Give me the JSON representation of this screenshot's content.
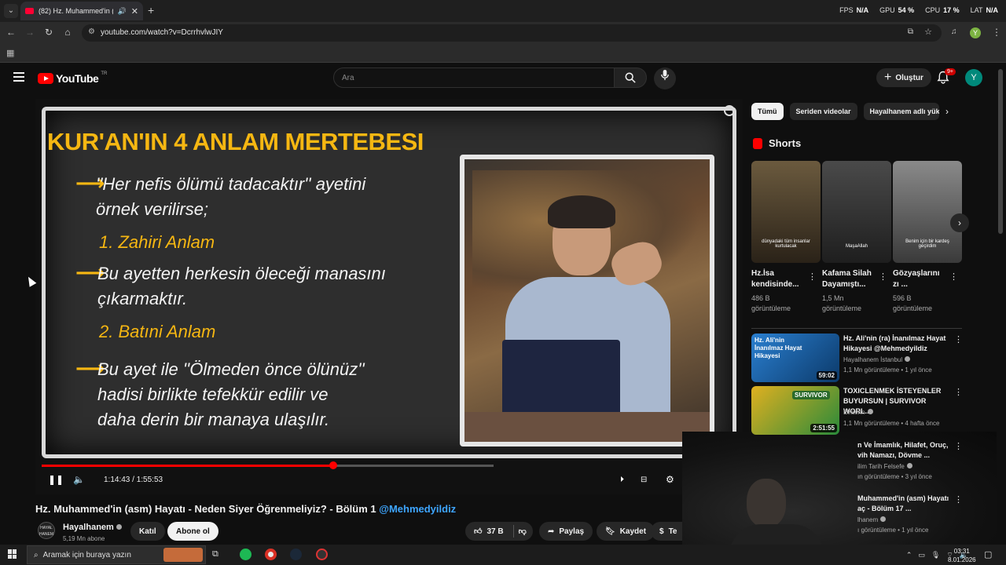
{
  "browser": {
    "tab_title": "(82) Hz. Muhammed'in (asm)",
    "url": "youtube.com/watch?v=DcrrhvlwJIY",
    "profile_letter": "Y",
    "perf": [
      {
        "label": "FPS",
        "value": "N/A"
      },
      {
        "label": "GPU",
        "value": "54 %"
      },
      {
        "label": "CPU",
        "value": "17 %"
      },
      {
        "label": "LAT",
        "value": "N/A"
      }
    ]
  },
  "masthead": {
    "logo": "YouTube",
    "country": "TR",
    "search_placeholder": "Ara",
    "create_label": "Oluştur",
    "notif_badge": "9+",
    "avatar_letter": "Y"
  },
  "video": {
    "slide_title": "KUR'AN'IN 4 ANLAM MERTEBESI",
    "lines": [
      "''Her nefis ölümü tadacaktır'' ayetini",
      "örnek verilirse;",
      "1. Zahiri Anlam",
      "Bu ayetten herkesin öleceği manasını",
      "çıkarmaktır.",
      "2. Batıni Anlam",
      "Bu ayet ile ''Ölmeden önce ölünüz''",
      "hadisi birlikte tefekkür edilir ve",
      "daha derin bir manaya ulaşılır."
    ],
    "time_current": "1:14:43",
    "time_total": "1:55:53",
    "progress": 0.645,
    "title": "Hz. Muhammed'in (asm) Hayatı - Neden Siyer Öğrenmeliyiz? - Bölüm 1",
    "title_link": "@Mehmedyildiz",
    "channel": "Hayalhanem",
    "channel_logo_text": "HAYAL HANEM",
    "subs": "5,19 Mn abone",
    "join": "Katıl",
    "subscribe": "Abone ol",
    "likes": "37 B",
    "share": "Paylaş",
    "save": "Kaydet",
    "more_action": "Te"
  },
  "sidebar": {
    "chips": [
      "Tümü",
      "Seriden videolar",
      "Hayalhanem adlı yükl"
    ],
    "shorts_heading": "Shorts",
    "shorts": [
      {
        "title1": "Hz.İsa",
        "title2": "kendisinde...",
        "views1": "486 B",
        "views2": "görüntüleme",
        "caption": "dünyadaki tüm insanlar kurtulacak",
        "color1": "#6b5a3e",
        "color2": "#2a2218"
      },
      {
        "title1": "Kafama Silah",
        "title2": "Dayamıştı...",
        "views1": "1,5 Mn",
        "views2": "görüntüleme",
        "caption": "MaşaAllah",
        "color1": "#4a4a4a",
        "color2": "#1e1e1e"
      },
      {
        "title1": "Gözyaşlarını",
        "title2": "zı ...",
        "views1": "596 B",
        "views2": "görüntüleme",
        "caption": "Benim için bir kardeş geçirdim",
        "color1": "#8a8a8a",
        "color2": "#3a3a3a"
      }
    ],
    "recommended": [
      {
        "title": "Hz. Ali'nin (ra) İnanılmaz Hayat Hikayesi @Mehmedyildiz",
        "channel": "Hayalhanem İstanbul",
        "meta": "1,1 Mn görüntüleme • 1 yıl önce",
        "duration": "59:02",
        "thumb_text": "Hz. Ali'nin İnanılmaz Hayat Hikayesi",
        "color1": "#2a7fd0",
        "color2": "#0c3a6a"
      },
      {
        "title": "TOXICLENMEK İSTEYENLER BUYURSUN | SURVIVOR WORL...",
        "channel": "Elraenn",
        "meta": "1,1 Mn görüntüleme • 4 hafta önce",
        "duration": "2:51:55",
        "thumb_text": "SURVIVOR",
        "color1": "#e0b020",
        "color2": "#2a8a3a"
      },
      {
        "title": "n Ve İmamlık, Hilafet, Oruç, vih Namazı, Dövme ...",
        "channel": "ilim Tarih Felsefe",
        "meta": "ın görüntüleme • 3 yıl önce",
        "duration": "",
        "thumb_text": "",
        "color1": "#1a1a1a",
        "color2": "#0a0a0a"
      },
      {
        "title": "Muhammed'in (asm) Hayatı aç - Bölüm 17 ...",
        "channel": "lhanem",
        "meta": "ı görüntüleme • 1 yıl önce",
        "duration": "",
        "thumb_text": "",
        "color1": "#1a1a1a",
        "color2": "#0a0a0a"
      }
    ]
  },
  "taskbar": {
    "search_text": "Aramak için buraya yazın",
    "time": "03:31",
    "date": "8.01.2026"
  }
}
